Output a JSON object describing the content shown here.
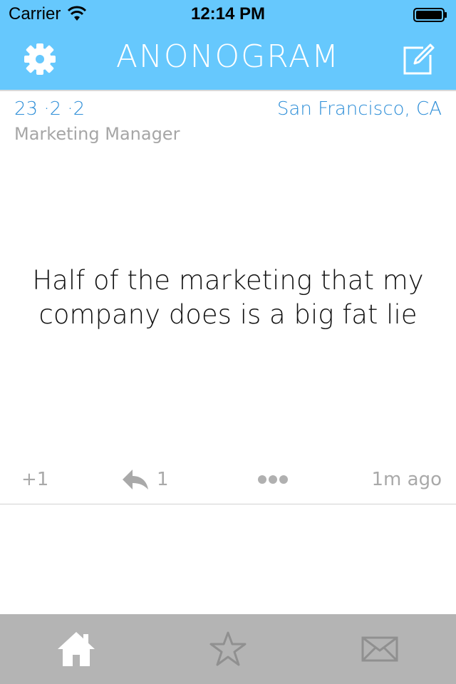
{
  "status_bar": {
    "carrier": "Carrier",
    "time": "12:14 PM"
  },
  "nav": {
    "title": "ANONOGRAM",
    "left_icon": "gear-icon",
    "right_icon": "compose-icon"
  },
  "post": {
    "stats": "23 ·2 ·2",
    "location": "San Francisco, CA",
    "job": "Marketing Manager",
    "message": "Half of the marketing that my company does is a big fat lie",
    "upvote_label": "+1",
    "reply_count": "1",
    "age": "1m ago",
    "icons": {
      "reply": "reply-icon",
      "more": "more-dots-icon"
    }
  },
  "tabs": [
    {
      "name": "home",
      "icon": "home-icon",
      "active": true
    },
    {
      "name": "favorites",
      "icon": "star-icon",
      "active": false
    },
    {
      "name": "messages",
      "icon": "mail-icon",
      "active": false
    }
  ],
  "colors": {
    "accent": "#66c8fd",
    "blue_text": "#2f8fd8",
    "gray_text": "#a6a6a6",
    "tab_bar": "#b4b4b4"
  }
}
